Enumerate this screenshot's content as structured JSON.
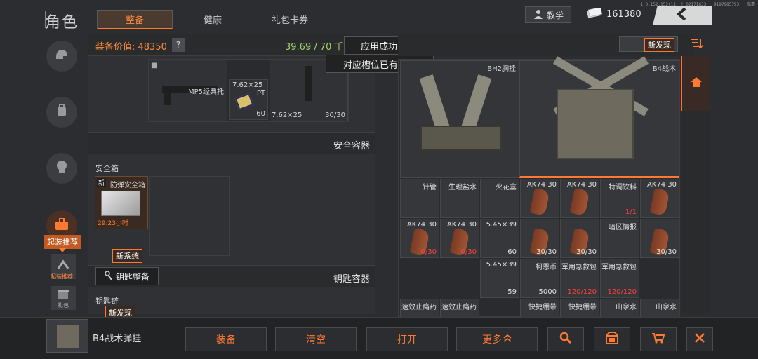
{
  "system": {
    "status_text": "1.0.152.152(11) | 02171633 | 9197985793 | 高清"
  },
  "header": {
    "title": "角色",
    "tabs": [
      {
        "label": "整备",
        "active": true
      },
      {
        "label": "健康",
        "active": false
      },
      {
        "label": "礼包卡券",
        "active": false
      }
    ],
    "teach_label": "教学",
    "currency_value": "161380"
  },
  "left_nav": {
    "items": [
      {
        "icon": "helmet-icon"
      },
      {
        "icon": "backpack-icon"
      },
      {
        "icon": "character-icon"
      },
      {
        "icon": "starter-kit-icon",
        "label": "起装推荐",
        "active": true
      },
      {
        "icon": "gear-recommend-icon",
        "label": "起装推荐"
      },
      {
        "icon": "gift-icon",
        "label": "礼包"
      }
    ]
  },
  "equipment": {
    "value_label": "装备价值: 48350",
    "help_label": "?",
    "weight_label": "39.69 / 70 千"
  },
  "weapon_slot": {
    "stock_name": "MP5经典托",
    "ammo_name": "7.62×25",
    "ammo_sub": "PT",
    "ammo_count": "60",
    "mag_name": "7.62×25",
    "mag_count": "30/30"
  },
  "safe_container": {
    "header": "安全容器",
    "section_label": "安全箱",
    "item_name": "防弹安全箱",
    "item_badge": "新",
    "item_timer": "29:23小时"
  },
  "key_container": {
    "new_system_tag": "新系统",
    "organize_button": "钥匙整备",
    "header": "钥匙容器",
    "section_label": "钥匙链",
    "new_found_tag": "新发现"
  },
  "toasts": [
    "应用成功",
    "对应槽位已有装备"
  ],
  "right_panel": {
    "new_found_tag": "新发现",
    "vest_left_name": "BH2胸挂",
    "vest_right_name": "B4战术",
    "items": [
      {
        "name": "针管",
        "count": ""
      },
      {
        "name": "生理盐水",
        "count": ""
      },
      {
        "name": "火花塞",
        "count": ""
      },
      {
        "name": "AK74 30",
        "count": ""
      },
      {
        "name": "AK74 30",
        "count": ""
      },
      {
        "name": "特调饮料",
        "count": "1/1"
      },
      {
        "name": "AK74 30",
        "count": ""
      },
      {
        "name": "AK74 30",
        "count": "0/30"
      },
      {
        "name": "AK74 30",
        "count": "0/30"
      },
      {
        "name": "5.45×39",
        "count": "60"
      },
      {
        "name": "",
        "count": "30/30"
      },
      {
        "name": "",
        "count": "30/30"
      },
      {
        "name": "暗区情报",
        "count": ""
      },
      {
        "name": "",
        "count": "30/30"
      },
      {
        "name": "5.45×39",
        "count": "59"
      },
      {
        "name": "柯恩币",
        "count": "5000"
      },
      {
        "name": "军用急救包",
        "count": "120/120"
      },
      {
        "name": "军用急救包",
        "count": "120/120"
      },
      {
        "name": "速效止痛药",
        "count": ""
      },
      {
        "name": "速效止痛药",
        "count": ""
      },
      {
        "name": "快捷绷带",
        "count": ""
      },
      {
        "name": "快捷绷带",
        "count": ""
      },
      {
        "name": "山泉水",
        "count": ""
      },
      {
        "name": "山泉水",
        "count": ""
      }
    ]
  },
  "bottom_bar": {
    "selected_item_name": "B4战术弹挂",
    "buttons": [
      "装备",
      "清空",
      "打开",
      "更多"
    ]
  },
  "colors": {
    "accent": "#ff7a30",
    "weight_green": "#9fd36a",
    "danger": "#ff4040"
  }
}
